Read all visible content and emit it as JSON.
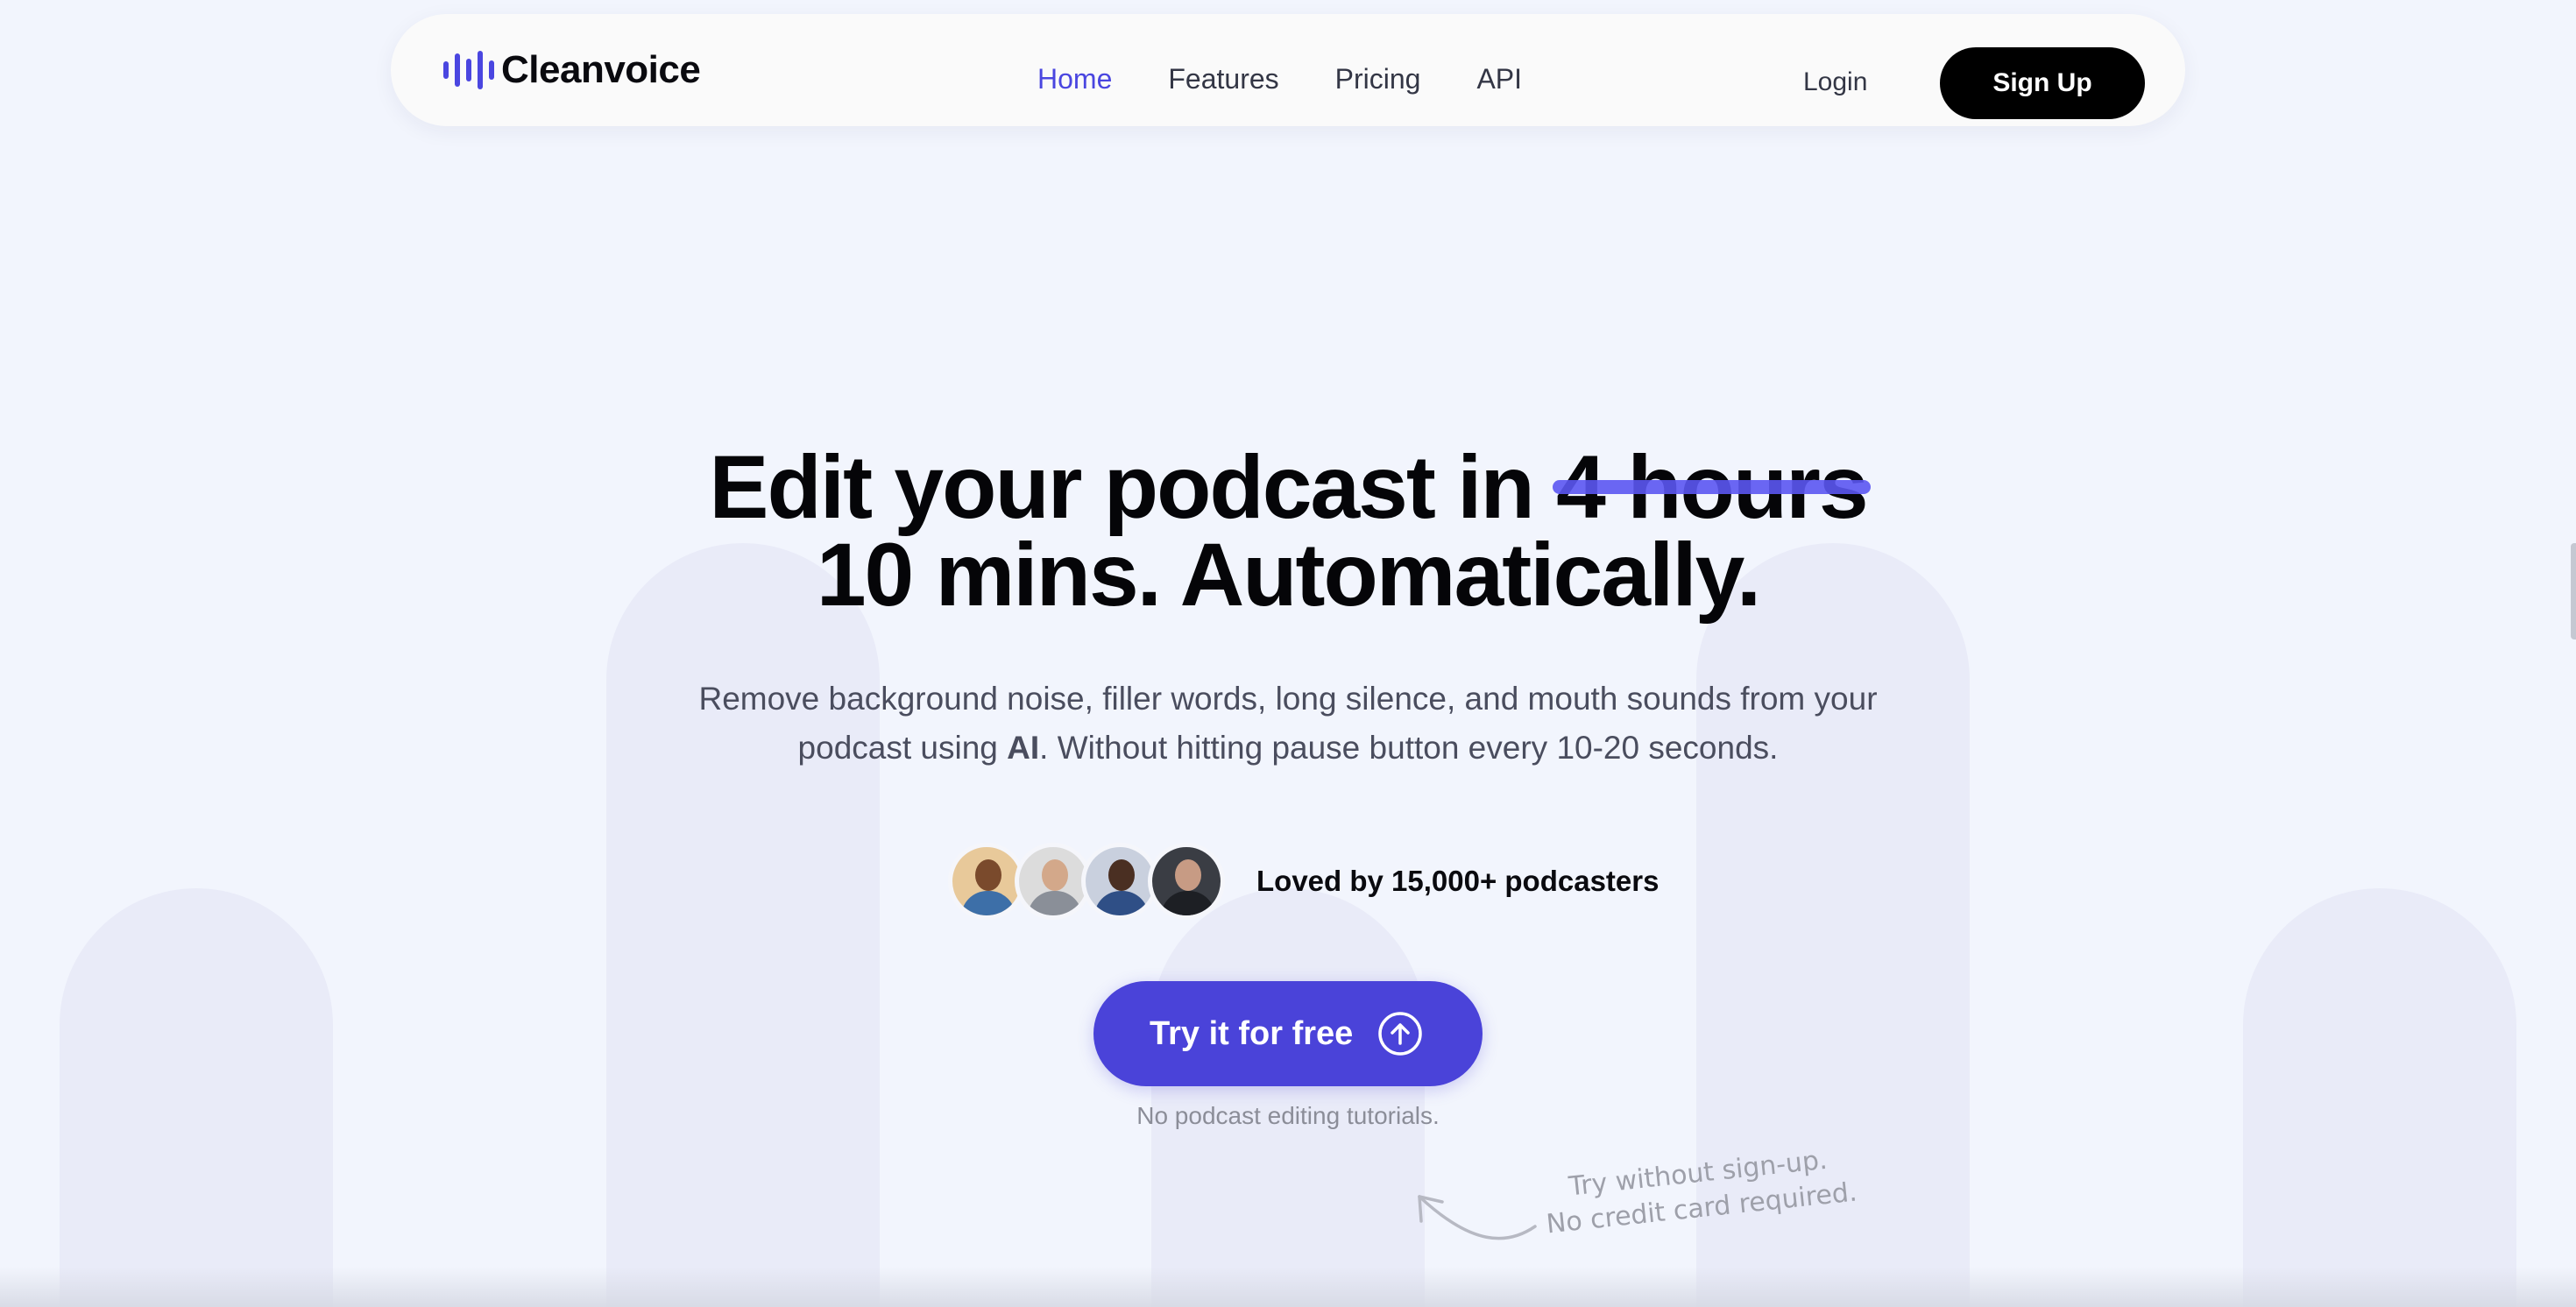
{
  "nav": {
    "logo_text": "Cleanvoice",
    "links": [
      "Home",
      "Features",
      "Pricing",
      "API"
    ],
    "active_link": "Home",
    "login": "Login",
    "signup": "Sign Up"
  },
  "hero": {
    "title_prefix": "Edit your podcast in",
    "title_struck": "4 hours",
    "title_line2": "10 mins. Automatically.",
    "subtitle_before": "Remove background noise, filler words, long silence, and mouth sounds from your podcast using",
    "subtitle_bold": "AI",
    "subtitle_after": ". Without hitting pause button every 10-20 seconds.",
    "social_proof": "Loved by 15,000+ podcasters",
    "cta_label": "Try it for free",
    "cta_note": "No podcast editing tutorials.",
    "hand_note_line1": "Try without sign-up.",
    "hand_note_line2": "No credit card required."
  },
  "colors": {
    "accent": "#4a43d9",
    "background": "#f2f5fd",
    "strike": "#5b57f2"
  }
}
